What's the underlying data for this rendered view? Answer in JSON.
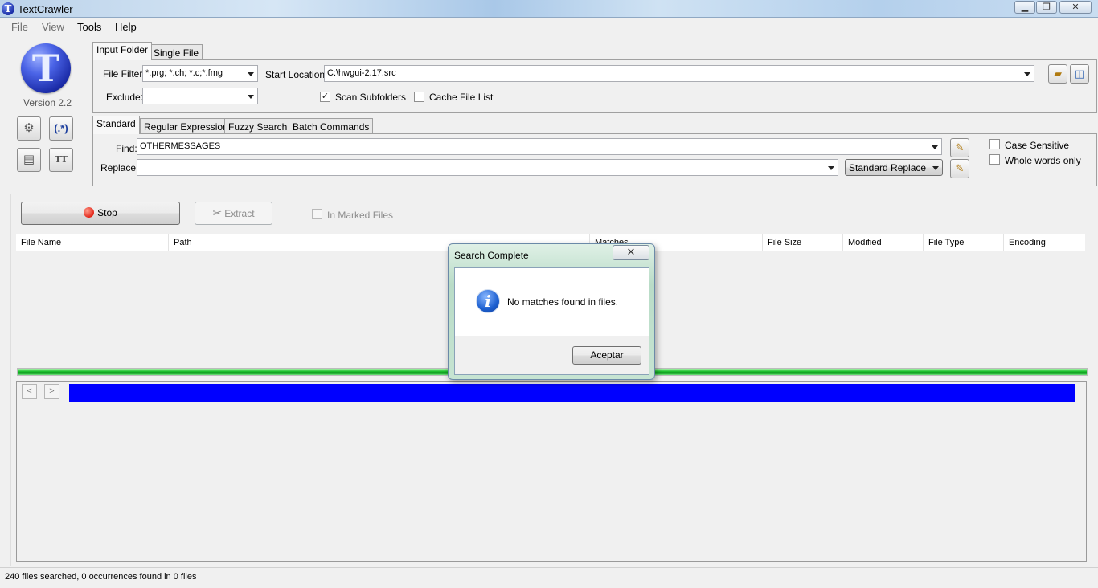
{
  "window": {
    "title": "TextCrawler",
    "controls": {
      "minimize": "▭",
      "maximize": "❐",
      "close": "✕"
    }
  },
  "menu": {
    "items": [
      "File",
      "View",
      "Tools",
      "Help"
    ]
  },
  "sidebar": {
    "logo_letter": "T",
    "version": "Version 2.2",
    "tt_label": "TT"
  },
  "input_panel": {
    "tabs": [
      "Input Folder",
      "Single File"
    ],
    "file_filter_label": "File Filter:",
    "file_filter_value": "*.prg; *.ch; *.c;*.fmg",
    "start_location_label": "Start Location:",
    "start_location_value": "C:\\hwgui-2.17.src",
    "exclude_label": "Exclude:",
    "exclude_value": "",
    "scan_subfolders_label": "Scan Subfolders",
    "scan_subfolders_checked": true,
    "cache_file_list_label": "Cache File List",
    "cache_file_list_checked": false
  },
  "search_panel": {
    "tabs": [
      "Standard",
      "Regular Expression",
      "Fuzzy Search",
      "Batch Commands"
    ],
    "find_label": "Find:",
    "find_value": "OTHERMESSAGES",
    "replace_label": "Replace:",
    "replace_value": "",
    "replace_mode": "Standard Replace",
    "case_sensitive_label": "Case Sensitive",
    "whole_words_label": "Whole words only"
  },
  "actions": {
    "stop_label": "Stop",
    "extract_label": "Extract",
    "in_marked_files_label": "In Marked Files"
  },
  "results": {
    "columns": [
      "File Name",
      "Path",
      "Matches",
      "File Size",
      "Modified",
      "File Type",
      "Encoding"
    ],
    "progress": 1.0
  },
  "preview": {
    "prev": "<",
    "next": ">"
  },
  "status": {
    "text": "240 files searched, 0 occurrences found in 0 files"
  },
  "dialog": {
    "title": "Search Complete",
    "close": "✕",
    "message": "No matches found in files.",
    "ok_label": "Aceptar",
    "icon_glyph": "i"
  },
  "colors": {
    "progress": "#19c02a",
    "preview_bar": "#0000ff",
    "logo": "#1a2aa6"
  }
}
